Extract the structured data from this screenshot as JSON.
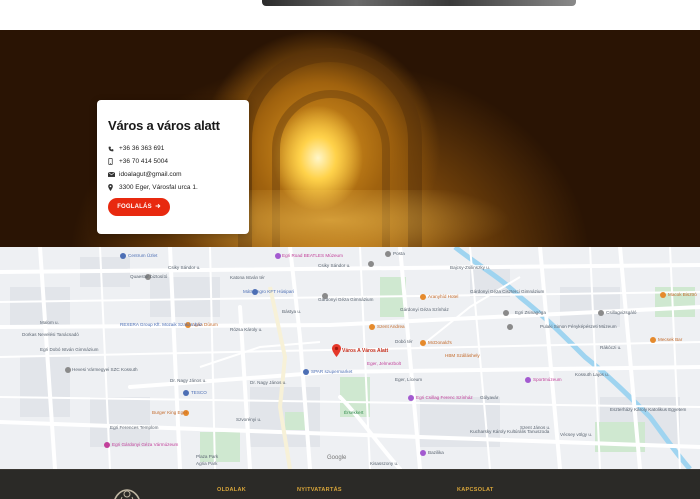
{
  "venue": {
    "title": "Város a város alatt",
    "phone_1": "+36 36 363 691",
    "phone_2": "+36 70 414 5004",
    "email": "idoalagut@gmail.com",
    "address": "3300 Eger, Városfal urca 1.",
    "book_label": "FOGLALÁS"
  },
  "map": {
    "pin_label": "Város A Város Alatt",
    "attribution": "Google",
    "streets": [
      "Csiky Sándor u.",
      "Csiky Sándor u.",
      "Katona István tér",
      "Bástya u.",
      "Rózsa Károly u.",
      "Dr. Nagy János u.",
      "Dr. Nagy János u.",
      "Szvorényi u.",
      "Kossuth Lajos u.",
      "Szent János u.",
      "Rákóczi u.",
      "Vécsey völgy u.",
      "Malom u.",
      "Kisasszony u.",
      "Bajcsy-Zsilinszky u."
    ],
    "pois": [
      "Egri Road BEATLES Múzeum",
      "Posta",
      "Quaestor biztosító",
      "Centrum Üzlet",
      "Mátra-Agro KFT Húsipari",
      "Gárdonyi Géza Gimnázium",
      "Gárdonyi Géza Ciszterci Gimnázium",
      "Agria Dúrum",
      "Szent Andrea",
      "REXERA Group Kft. Mozaik Szakáruház",
      "Dorkas Nevelési Tanácsadó",
      "Hevesi Vármegyei SZC Kossuth",
      "SPAR szupermarket",
      "TESCO",
      "Burger King Eger",
      "Agria Park",
      "Egri Ferences Templom",
      "Egri Gárdonyi Géza Vármúzeum",
      "Egri Dobó István Gimnázium",
      "Aranyhíd Hotel",
      "Gárdonyi Géza Színház",
      "Dobó tér",
      "Eger, Jelmezbolt",
      "McDonald's",
      "HBM Szálláshely",
      "Eger, Líceum",
      "Egri Csillag Ferenc Színház",
      "Érsekkert",
      "Kucharsky Károly Kultúrális Tanuszoda",
      "Sportmúzeum",
      "Gólyavár",
      "Macok Bisztró",
      "Csillagvizsgáló",
      "Pulaki Simon Fényképészeti Múzeum",
      "Egri Zsinagóga",
      "Mecsek Bar",
      "Eszterházy Károly Katolikus Egyetem",
      "Plaza Park",
      "Bazilika"
    ]
  },
  "footer": {
    "col_1": "OLDALAK",
    "col_2": "NYITVATARTÁS",
    "col_3": "KAPCSOLAT"
  },
  "colors": {
    "accent": "#e8290f",
    "footer_bg": "#2b2a27",
    "footer_heading": "#d9a63a",
    "map_pin": "#e5382a"
  }
}
